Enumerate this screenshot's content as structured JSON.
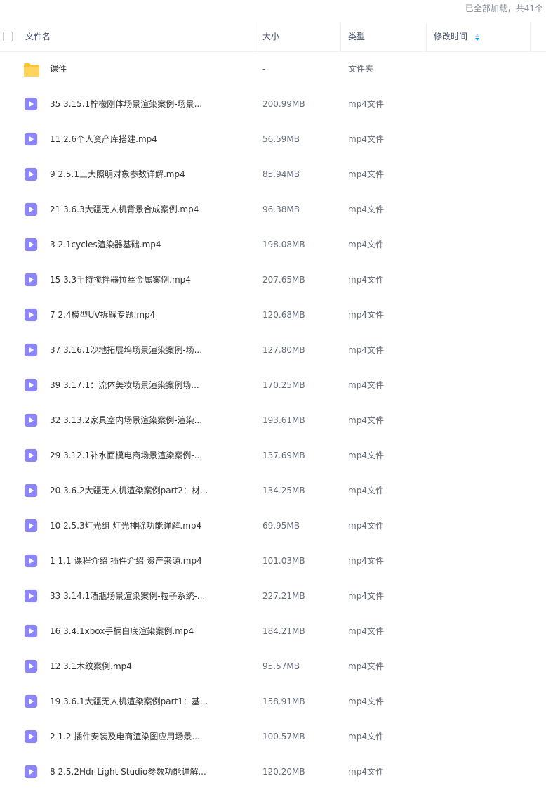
{
  "summary": "已全部加载，共41个",
  "columns": {
    "name": "文件名",
    "size": "大小",
    "type": "类型",
    "modified": "修改时间"
  },
  "files": [
    {
      "name": "课件",
      "size": "-",
      "type": "文件夹",
      "icon": "folder-icon"
    },
    {
      "name": "35 3.15.1柠檬刚体场景渲染案例-场景...",
      "size": "200.99MB",
      "type": "mp4文件",
      "icon": "video-file-icon"
    },
    {
      "name": "11 2.6个人资产库搭建.mp4",
      "size": "56.59MB",
      "type": "mp4文件",
      "icon": "video-file-icon"
    },
    {
      "name": "9 2.5.1三大照明对象参数详解.mp4",
      "size": "85.94MB",
      "type": "mp4文件",
      "icon": "video-file-icon"
    },
    {
      "name": "21 3.6.3大疆无人机背景合成案例.mp4",
      "size": "96.38MB",
      "type": "mp4文件",
      "icon": "video-file-icon"
    },
    {
      "name": "3 2.1cycles渲染器基础.mp4",
      "size": "198.08MB",
      "type": "mp4文件",
      "icon": "video-file-icon"
    },
    {
      "name": "15 3.3手持搅拌器拉丝金属案例.mp4",
      "size": "207.65MB",
      "type": "mp4文件",
      "icon": "video-file-icon"
    },
    {
      "name": "7 2.4模型UV拆解专题.mp4",
      "size": "120.68MB",
      "type": "mp4文件",
      "icon": "video-file-icon"
    },
    {
      "name": "37 3.16.1沙地拓展坞场景渲染案例-场...",
      "size": "127.80MB",
      "type": "mp4文件",
      "icon": "video-file-icon"
    },
    {
      "name": "39 3.17.1：流体美妆场景渲染案例场...",
      "size": "170.25MB",
      "type": "mp4文件",
      "icon": "video-file-icon"
    },
    {
      "name": "32 3.13.2家具室内场景渲染案例-渲染...",
      "size": "193.61MB",
      "type": "mp4文件",
      "icon": "video-file-icon"
    },
    {
      "name": "29 3.12.1补水面模电商场景渲染案例-...",
      "size": "137.69MB",
      "type": "mp4文件",
      "icon": "video-file-icon"
    },
    {
      "name": "20 3.6.2大疆无人机渲染案例part2：材...",
      "size": "134.25MB",
      "type": "mp4文件",
      "icon": "video-file-icon"
    },
    {
      "name": "10 2.5.3灯光组 灯光排除功能详解.mp4",
      "size": "69.95MB",
      "type": "mp4文件",
      "icon": "video-file-icon"
    },
    {
      "name": "1 1.1 课程介绍 插件介绍 资产来源.mp4",
      "size": "101.03MB",
      "type": "mp4文件",
      "icon": "video-file-icon"
    },
    {
      "name": "33 3.14.1酒瓶场景渲染案例-粒子系统-...",
      "size": "227.21MB",
      "type": "mp4文件",
      "icon": "video-file-icon"
    },
    {
      "name": "16 3.4.1xbox手柄白底渲染案例.mp4",
      "size": "184.21MB",
      "type": "mp4文件",
      "icon": "video-file-icon"
    },
    {
      "name": "12 3.1木纹案例.mp4",
      "size": "95.57MB",
      "type": "mp4文件",
      "icon": "video-file-icon"
    },
    {
      "name": "19 3.6.1大疆无人机渲染案例part1：基...",
      "size": "158.91MB",
      "type": "mp4文件",
      "icon": "video-file-icon"
    },
    {
      "name": "2 1.2 插件安装及电商渲染图应用场景....",
      "size": "100.57MB",
      "type": "mp4文件",
      "icon": "video-file-icon"
    },
    {
      "name": "8 2.5.2Hdr Light Studio参数功能详解...",
      "size": "120.20MB",
      "type": "mp4文件",
      "icon": "video-file-icon"
    }
  ],
  "colors": {
    "folder": "#fcc530",
    "video": "#8b85f7",
    "sort_arrow": "#06a7ff"
  }
}
